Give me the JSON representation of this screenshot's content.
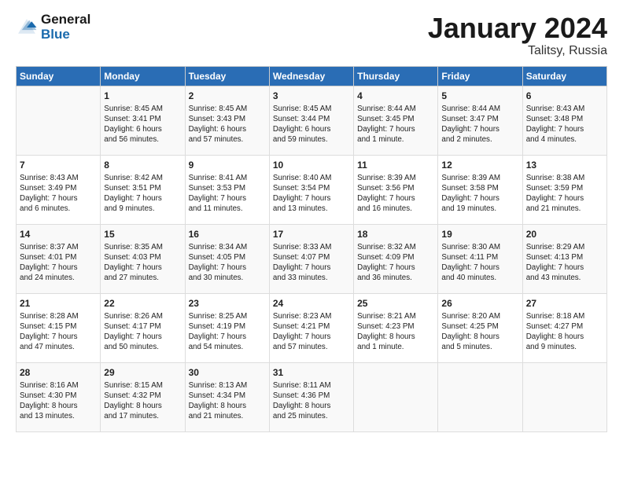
{
  "header": {
    "logo_line1": "General",
    "logo_line2": "Blue",
    "month": "January 2024",
    "location": "Talitsy, Russia"
  },
  "days_of_week": [
    "Sunday",
    "Monday",
    "Tuesday",
    "Wednesday",
    "Thursday",
    "Friday",
    "Saturday"
  ],
  "weeks": [
    [
      {
        "day": "",
        "info": ""
      },
      {
        "day": "1",
        "info": "Sunrise: 8:45 AM\nSunset: 3:41 PM\nDaylight: 6 hours\nand 56 minutes."
      },
      {
        "day": "2",
        "info": "Sunrise: 8:45 AM\nSunset: 3:43 PM\nDaylight: 6 hours\nand 57 minutes."
      },
      {
        "day": "3",
        "info": "Sunrise: 8:45 AM\nSunset: 3:44 PM\nDaylight: 6 hours\nand 59 minutes."
      },
      {
        "day": "4",
        "info": "Sunrise: 8:44 AM\nSunset: 3:45 PM\nDaylight: 7 hours\nand 1 minute."
      },
      {
        "day": "5",
        "info": "Sunrise: 8:44 AM\nSunset: 3:47 PM\nDaylight: 7 hours\nand 2 minutes."
      },
      {
        "day": "6",
        "info": "Sunrise: 8:43 AM\nSunset: 3:48 PM\nDaylight: 7 hours\nand 4 minutes."
      }
    ],
    [
      {
        "day": "7",
        "info": "Sunrise: 8:43 AM\nSunset: 3:49 PM\nDaylight: 7 hours\nand 6 minutes."
      },
      {
        "day": "8",
        "info": "Sunrise: 8:42 AM\nSunset: 3:51 PM\nDaylight: 7 hours\nand 9 minutes."
      },
      {
        "day": "9",
        "info": "Sunrise: 8:41 AM\nSunset: 3:53 PM\nDaylight: 7 hours\nand 11 minutes."
      },
      {
        "day": "10",
        "info": "Sunrise: 8:40 AM\nSunset: 3:54 PM\nDaylight: 7 hours\nand 13 minutes."
      },
      {
        "day": "11",
        "info": "Sunrise: 8:39 AM\nSunset: 3:56 PM\nDaylight: 7 hours\nand 16 minutes."
      },
      {
        "day": "12",
        "info": "Sunrise: 8:39 AM\nSunset: 3:58 PM\nDaylight: 7 hours\nand 19 minutes."
      },
      {
        "day": "13",
        "info": "Sunrise: 8:38 AM\nSunset: 3:59 PM\nDaylight: 7 hours\nand 21 minutes."
      }
    ],
    [
      {
        "day": "14",
        "info": "Sunrise: 8:37 AM\nSunset: 4:01 PM\nDaylight: 7 hours\nand 24 minutes."
      },
      {
        "day": "15",
        "info": "Sunrise: 8:35 AM\nSunset: 4:03 PM\nDaylight: 7 hours\nand 27 minutes."
      },
      {
        "day": "16",
        "info": "Sunrise: 8:34 AM\nSunset: 4:05 PM\nDaylight: 7 hours\nand 30 minutes."
      },
      {
        "day": "17",
        "info": "Sunrise: 8:33 AM\nSunset: 4:07 PM\nDaylight: 7 hours\nand 33 minutes."
      },
      {
        "day": "18",
        "info": "Sunrise: 8:32 AM\nSunset: 4:09 PM\nDaylight: 7 hours\nand 36 minutes."
      },
      {
        "day": "19",
        "info": "Sunrise: 8:30 AM\nSunset: 4:11 PM\nDaylight: 7 hours\nand 40 minutes."
      },
      {
        "day": "20",
        "info": "Sunrise: 8:29 AM\nSunset: 4:13 PM\nDaylight: 7 hours\nand 43 minutes."
      }
    ],
    [
      {
        "day": "21",
        "info": "Sunrise: 8:28 AM\nSunset: 4:15 PM\nDaylight: 7 hours\nand 47 minutes."
      },
      {
        "day": "22",
        "info": "Sunrise: 8:26 AM\nSunset: 4:17 PM\nDaylight: 7 hours\nand 50 minutes."
      },
      {
        "day": "23",
        "info": "Sunrise: 8:25 AM\nSunset: 4:19 PM\nDaylight: 7 hours\nand 54 minutes."
      },
      {
        "day": "24",
        "info": "Sunrise: 8:23 AM\nSunset: 4:21 PM\nDaylight: 7 hours\nand 57 minutes."
      },
      {
        "day": "25",
        "info": "Sunrise: 8:21 AM\nSunset: 4:23 PM\nDaylight: 8 hours\nand 1 minute."
      },
      {
        "day": "26",
        "info": "Sunrise: 8:20 AM\nSunset: 4:25 PM\nDaylight: 8 hours\nand 5 minutes."
      },
      {
        "day": "27",
        "info": "Sunrise: 8:18 AM\nSunset: 4:27 PM\nDaylight: 8 hours\nand 9 minutes."
      }
    ],
    [
      {
        "day": "28",
        "info": "Sunrise: 8:16 AM\nSunset: 4:30 PM\nDaylight: 8 hours\nand 13 minutes."
      },
      {
        "day": "29",
        "info": "Sunrise: 8:15 AM\nSunset: 4:32 PM\nDaylight: 8 hours\nand 17 minutes."
      },
      {
        "day": "30",
        "info": "Sunrise: 8:13 AM\nSunset: 4:34 PM\nDaylight: 8 hours\nand 21 minutes."
      },
      {
        "day": "31",
        "info": "Sunrise: 8:11 AM\nSunset: 4:36 PM\nDaylight: 8 hours\nand 25 minutes."
      },
      {
        "day": "",
        "info": ""
      },
      {
        "day": "",
        "info": ""
      },
      {
        "day": "",
        "info": ""
      }
    ]
  ]
}
